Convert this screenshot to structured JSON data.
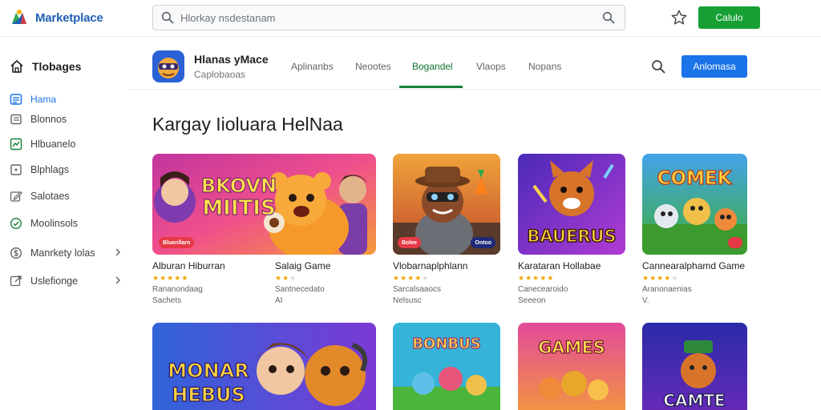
{
  "header": {
    "brand": "Marketplace",
    "search_placeholder": "Hlorkay nsdestanam",
    "primary_button": "Calulo"
  },
  "sidebar": {
    "title": "Tlobages",
    "items": [
      {
        "label": "Hama",
        "icon": "grid-icon",
        "active": true
      },
      {
        "label": "Blonnos",
        "icon": "list-icon"
      },
      {
        "label": "Hlbuanelo",
        "icon": "chart-icon"
      },
      {
        "label": "Blphlags",
        "icon": "tag-icon"
      },
      {
        "label": "Salotaes",
        "icon": "edit-icon"
      },
      {
        "label": "Moolinsols",
        "icon": "chat-icon"
      },
      {
        "label": "Manrkety lolas",
        "icon": "dollar-icon",
        "chevron": true
      },
      {
        "label": "Uslefionge",
        "icon": "link-icon",
        "chevron": true
      }
    ]
  },
  "app": {
    "title": "Hlanas yMace",
    "subtitle": "Caplobaoas",
    "tabs": [
      "Aplinanbs",
      "Neootes",
      "Bogandel",
      "Vlaops",
      "Nopans"
    ],
    "active_tab": 2,
    "action_button": "Anlomasa"
  },
  "section": {
    "title": "Kargay Iioluara HelNaa"
  },
  "cards": [
    {
      "title": "Alburan Hiburran",
      "meta1": "Rananondaag",
      "meta2": "Sachets",
      "art": "BKOVN\nMIITIS",
      "badge": "Bluenllarn"
    },
    {
      "title": "Salaig Game",
      "meta1": "Santnecedato",
      "meta2": "AI",
      "art": "",
      "badge": ""
    },
    {
      "title": "Vlobarnaplphlann",
      "meta1": "Sarcalsaaocs",
      "meta2": "Nelsusc",
      "art": "",
      "badge": "Bolee"
    },
    {
      "title": "Karataran Hollabae",
      "meta1": "Canecearoido",
      "meta2": "Seeeon",
      "art": "BAUERUS",
      "badge": ""
    },
    {
      "title": "Cannearalphamd Game",
      "meta1": "Aranonaenias",
      "meta2": "V.",
      "art": "COMEK",
      "badge": ""
    },
    {
      "title": "",
      "meta1": "",
      "meta2": "",
      "art": "MONAR\nHEBUS",
      "badge": ""
    },
    {
      "title": "",
      "meta1": "",
      "meta2": "",
      "art": "BONBUS",
      "badge": ""
    },
    {
      "title": "",
      "meta1": "",
      "meta2": "",
      "art": "GAMES",
      "badge": ""
    },
    {
      "title": "",
      "meta1": "",
      "meta2": "",
      "art": "CAMTE",
      "badge": ""
    }
  ],
  "card2_badges": [
    "Bolee",
    "Ontoo"
  ],
  "colors": {
    "brand_blue": "#1f5fb4",
    "primary_green": "#16a034",
    "accent_blue": "#1a73e8",
    "active_tab_green": "#188038",
    "star": "#f2a600"
  }
}
